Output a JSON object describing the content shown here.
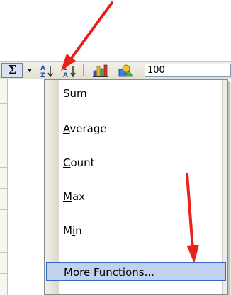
{
  "toolbar": {
    "autosum_symbol": "Σ",
    "dropdown_arrow": "▾",
    "zoom_value": "100"
  },
  "menu": {
    "items": [
      {
        "mnemonic": "S",
        "rest": "um",
        "highlighted": false
      },
      {
        "mnemonic": "A",
        "rest": "verage",
        "highlighted": false
      },
      {
        "mnemonic": "C",
        "rest": "ount",
        "highlighted": false
      },
      {
        "mnemonic": "M",
        "rest": "ax",
        "highlighted": false
      },
      {
        "pre": "M",
        "mnemonic": "i",
        "rest": "n",
        "highlighted": false
      },
      {
        "pre": "More ",
        "mnemonic": "F",
        "rest": "unctions...",
        "highlighted": true
      }
    ]
  },
  "colors": {
    "annotation_arrow": "#e8221b",
    "highlight_fill": "#c1d2ee",
    "highlight_border": "#316ac5"
  },
  "icons": [
    "sum-icon",
    "sort-ascending-icon",
    "sort-descending-icon",
    "chart-wizard-icon",
    "drawing-icon"
  ]
}
